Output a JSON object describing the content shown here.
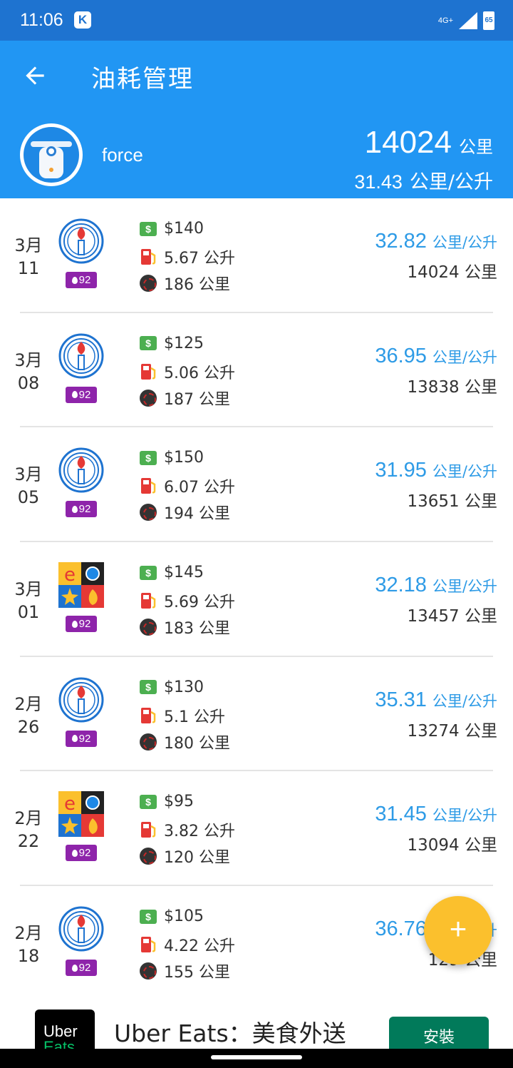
{
  "status_bar": {
    "time": "11:06",
    "app_icon": "K",
    "network": "4G+",
    "battery": "65"
  },
  "app_bar": {
    "title": "油耗管理",
    "user_name": "force",
    "total_km_value": "14024",
    "total_km_unit": "公里",
    "avg_econ_value": "31.43",
    "avg_econ_unit": "公里/公升"
  },
  "records": [
    {
      "month": "3月",
      "day": "11",
      "station": "cpc",
      "octane": "92",
      "price": "$140",
      "liters": "5.67 公升",
      "distance": "186 公里",
      "econ_value": "32.82",
      "econ_unit": "公里/公升",
      "odometer": "14024 公里"
    },
    {
      "month": "3月",
      "day": "08",
      "station": "cpc",
      "octane": "92",
      "price": "$125",
      "liters": "5.06 公升",
      "distance": "187 公里",
      "econ_value": "36.95",
      "econ_unit": "公里/公升",
      "odometer": "13838 公里"
    },
    {
      "month": "3月",
      "day": "05",
      "station": "cpc",
      "octane": "92",
      "price": "$150",
      "liters": "6.07 公升",
      "distance": "194 公里",
      "econ_value": "31.95",
      "econ_unit": "公里/公升",
      "odometer": "13651 公里"
    },
    {
      "month": "3月",
      "day": "01",
      "station": "fpcc",
      "octane": "92",
      "price": "$145",
      "liters": "5.69 公升",
      "distance": "183 公里",
      "econ_value": "32.18",
      "econ_unit": "公里/公升",
      "odometer": "13457 公里"
    },
    {
      "month": "2月",
      "day": "26",
      "station": "cpc",
      "octane": "92",
      "price": "$130",
      "liters": "5.1 公升",
      "distance": "180 公里",
      "econ_value": "35.31",
      "econ_unit": "公里/公升",
      "odometer": "13274 公里"
    },
    {
      "month": "2月",
      "day": "22",
      "station": "fpcc",
      "octane": "92",
      "price": "$95",
      "liters": "3.82 公升",
      "distance": "120 公里",
      "econ_value": "31.45",
      "econ_unit": "公里/公升",
      "odometer": "13094 公里"
    },
    {
      "month": "2月",
      "day": "18",
      "station": "cpc",
      "octane": "92",
      "price": "$105",
      "liters": "4.22 公升",
      "distance": "155 公里",
      "econ_value": "36.76",
      "econ_unit": "公里/公升",
      "odometer": "129 公里"
    }
  ],
  "fab": {
    "label": "+"
  },
  "ad": {
    "logo_line1": "Uber",
    "logo_line2": "Eats",
    "title": "Uber Eats：美食外送",
    "install_label": "安裝"
  }
}
